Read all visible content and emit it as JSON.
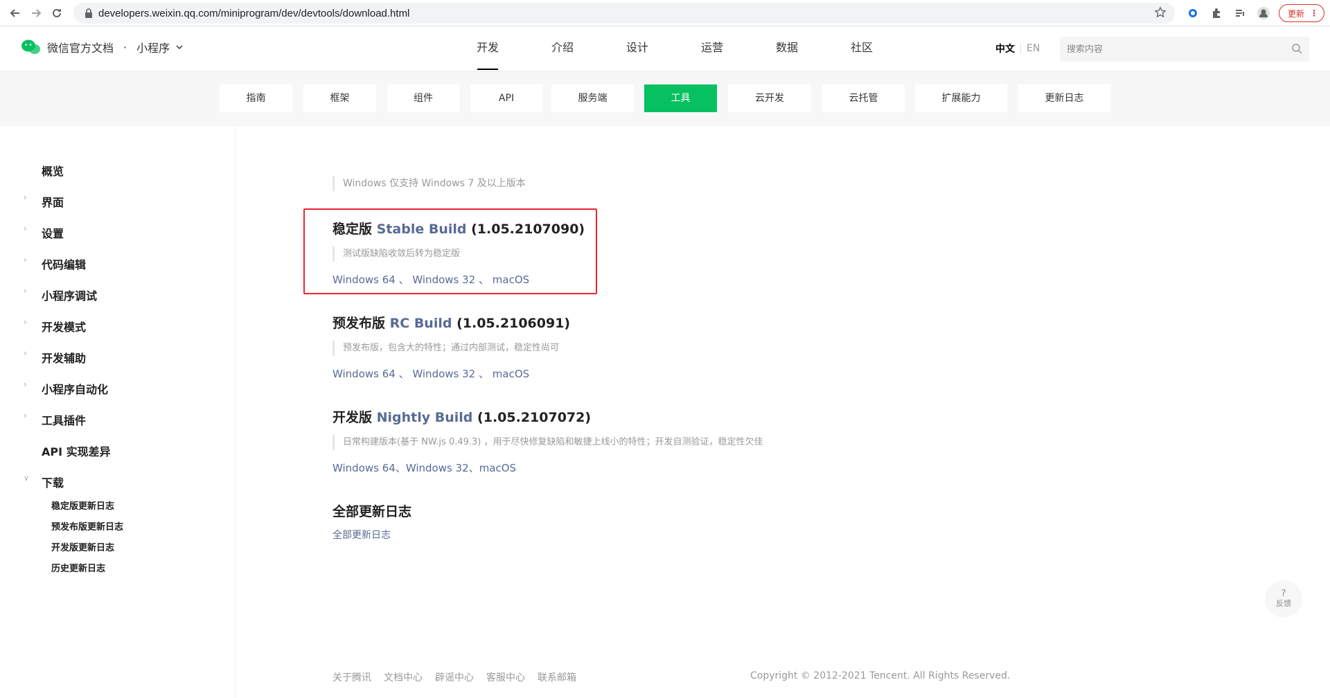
{
  "browser": {
    "url": "developers.weixin.qq.com/miniprogram/dev/devtools/download.html",
    "update_label": "更新"
  },
  "brand": {
    "title": "微信官方文档",
    "section": "小程序"
  },
  "topnav": {
    "items": [
      "开发",
      "介绍",
      "设计",
      "运营",
      "数据",
      "社区"
    ]
  },
  "lang": {
    "zh": "中文",
    "en": "EN"
  },
  "search": {
    "placeholder": "搜索内容"
  },
  "subnav": {
    "tabs": [
      "指南",
      "框架",
      "组件",
      "API",
      "服务端",
      "工具",
      "云开发",
      "云托管",
      "扩展能力",
      "更新日志"
    ]
  },
  "sidebar": {
    "items": [
      "概览",
      "界面",
      "设置",
      "代码编辑",
      "小程序调试",
      "开发模式",
      "开发辅助",
      "小程序自动化",
      "工具插件",
      "API 实现差异",
      "下载"
    ],
    "sub_items": [
      "稳定版更新日志",
      "预发布版更新日志",
      "开发版更新日志",
      "历史更新日志"
    ]
  },
  "content": {
    "windows_note": "Windows 仅支持 Windows 7 及以上版本",
    "stable": {
      "title_zh": "稳定版",
      "title_en": "Stable Build",
      "version": "(1.05.2107090)",
      "note": "测试版缺陷收敛后转为稳定版",
      "links": [
        "Windows 64",
        "Windows 32",
        "macOS"
      ]
    },
    "rc": {
      "title_zh": "预发布版",
      "title_en": "RC Build",
      "version": "(1.05.2106091)",
      "note": "预发布版，包含大的特性；通过内部测试，稳定性尚可",
      "links": [
        "Windows 64",
        "Windows 32",
        "macOS"
      ]
    },
    "nightly": {
      "title_zh": "开发版",
      "title_en": "Nightly Build",
      "version": "(1.05.2107072)",
      "note": "日常构建版本(基于 NW.js 0.49.3) ，用于尽快修复缺陷和敏捷上线小的特性；开发自测验证，稳定性欠佳",
      "links": [
        "Windows 64",
        "Windows 32",
        "macOS"
      ]
    },
    "changelog": {
      "title": "全部更新日志",
      "link": "全部更新日志"
    }
  },
  "footer": {
    "links": [
      "关于腾讯",
      "文档中心",
      "辟谣中心",
      "客服中心",
      "联系邮箱"
    ],
    "copyright": "Copyright © 2012-2021 Tencent. All Rights Reserved."
  },
  "feedback": {
    "icon": "?",
    "label": "反馈"
  },
  "colors": {
    "accent": "#07c160",
    "link": "#576b95",
    "highlight": "#e8262f"
  }
}
